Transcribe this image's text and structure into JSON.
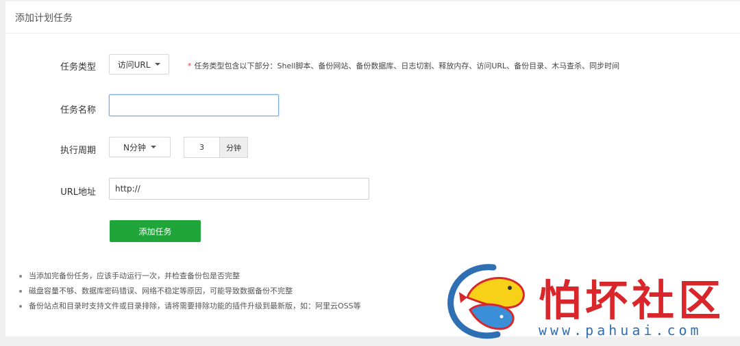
{
  "panel": {
    "title": "添加计划任务"
  },
  "form": {
    "task_type": {
      "label": "任务类型",
      "selected": "访问URL",
      "hint_star": "*",
      "hint": "任务类型包含以下部分：Shell脚本、备份网站、备份数据库、日志切割、释放内存、访问URL、备份目录、木马查杀、同步时间"
    },
    "task_name": {
      "label": "任务名称",
      "value": ""
    },
    "period": {
      "label": "执行周期",
      "selected": "N分钟",
      "value": "3",
      "unit": "分钟"
    },
    "url": {
      "label": "URL地址",
      "value": "http://"
    },
    "submit_label": "添加任务"
  },
  "notes": [
    "当添加完备份任务，应该手动运行一次，并检查备份包是否完整",
    "磁盘容量不够、数据库密码错误、网络不稳定等原因，可能导致数据备份不完整",
    "备份站点和目录时支持文件或目录排除，请将需要排除功能的插件升级到最新版，如：阿里云OSS等"
  ],
  "watermark": {
    "name": "怕坏社区",
    "url": "www.pahuai.com"
  },
  "colors": {
    "primary": "#20a53a",
    "required_star": "#e33333",
    "watermark_red": "#d9262a",
    "watermark_blue": "#2f6fb4"
  }
}
